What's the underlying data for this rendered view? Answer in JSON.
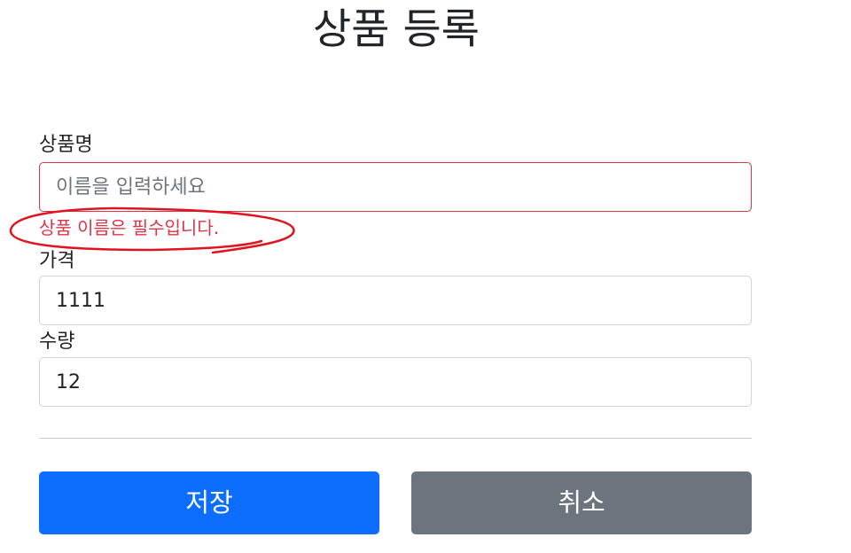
{
  "page": {
    "title": "상품 등록"
  },
  "form": {
    "item_name": {
      "label": "상품명",
      "placeholder": "이름을 입력하세요",
      "value": "",
      "error": "상품 이름은 필수입니다."
    },
    "price": {
      "label": "가격",
      "value": "1111"
    },
    "quantity": {
      "label": "수량",
      "value": "12"
    }
  },
  "buttons": {
    "save_label": "저장",
    "cancel_label": "취소"
  },
  "colors": {
    "primary": "#0d6efd",
    "secondary": "#6c757d",
    "danger": "#dc3545",
    "annotation": "#e0141e"
  }
}
